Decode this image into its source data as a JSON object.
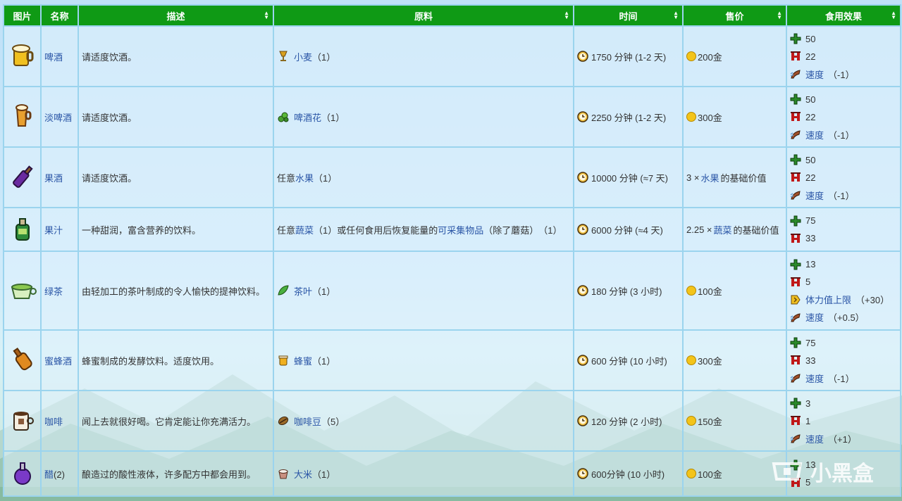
{
  "headers": {
    "image": "图片",
    "name": "名称",
    "desc": "描述",
    "ingredients": "原料",
    "time": "时间",
    "price": "售价",
    "effects": "食用效果"
  },
  "rows": [
    {
      "icon": "beer-icon",
      "name": "啤酒",
      "desc": "请适度饮酒。",
      "ingredient": {
        "prefix": "",
        "icon": "wheat-icon",
        "link": "小麦",
        "mid": "",
        "link2": "",
        "suffix": "（1）"
      },
      "time": "1750 分钟 (1-2 天)",
      "price": {
        "link": "",
        "text": "200金",
        "coin": true
      },
      "effects": [
        {
          "icon": "energy-icon",
          "text": "50"
        },
        {
          "icon": "health-icon",
          "text": "22"
        },
        {
          "icon": "speed-icon",
          "link": "速度",
          "text": "（-1）"
        }
      ]
    },
    {
      "icon": "pale-ale-icon",
      "name": "淡啤酒",
      "desc": "请适度饮酒。",
      "ingredient": {
        "prefix": "",
        "icon": "hops-icon",
        "link": "啤酒花",
        "mid": "",
        "link2": "",
        "suffix": "（1）"
      },
      "time": "2250 分钟 (1-2 天)",
      "price": {
        "link": "",
        "text": "300金",
        "coin": true
      },
      "effects": [
        {
          "icon": "energy-icon",
          "text": "50"
        },
        {
          "icon": "health-icon",
          "text": "22"
        },
        {
          "icon": "speed-icon",
          "link": "速度",
          "text": "（-1）"
        }
      ]
    },
    {
      "icon": "wine-icon",
      "name": "果酒",
      "desc": "请适度饮酒。",
      "ingredient": {
        "prefix": "任意",
        "icon": "",
        "link": "水果",
        "mid": "",
        "link2": "",
        "suffix": "（1）"
      },
      "time": "10000 分钟 (≈7 天)",
      "price": {
        "prefix": "3 × ",
        "link": "水果",
        "text": "的基础价值",
        "coin": false
      },
      "effects": [
        {
          "icon": "energy-icon",
          "text": "50"
        },
        {
          "icon": "health-icon",
          "text": "22"
        },
        {
          "icon": "speed-icon",
          "link": "速度",
          "text": "（-1）"
        }
      ]
    },
    {
      "icon": "juice-icon",
      "name": "果汁",
      "desc": "一种甜润，富含营养的饮料。",
      "ingredient": {
        "prefix": "任意",
        "icon": "",
        "link": "蔬菜",
        "mid": "（1）或任何食用后恢复能量的",
        "link2": "可采集物品",
        "suffix": "（除了蘑菇）　（1）"
      },
      "time": "6000 分钟 (≈4 天)",
      "price": {
        "prefix": "2.25 × ",
        "link": "蔬菜",
        "text": "的基础价值",
        "coin": false
      },
      "effects": [
        {
          "icon": "energy-icon",
          "text": "75"
        },
        {
          "icon": "health-icon",
          "text": "33"
        }
      ]
    },
    {
      "icon": "green-tea-icon",
      "name": "绿茶",
      "desc": "由轻加工的茶叶制成的令人愉快的提神饮料。",
      "ingredient": {
        "prefix": "",
        "icon": "tea-leaves-icon",
        "link": "茶叶",
        "mid": "",
        "link2": "",
        "suffix": "（1）"
      },
      "time": "180 分钟 (3 小时)",
      "price": {
        "link": "",
        "text": "100金",
        "coin": true
      },
      "effects": [
        {
          "icon": "energy-icon",
          "text": "13"
        },
        {
          "icon": "health-icon",
          "text": "5"
        },
        {
          "icon": "max-energy-icon",
          "link": "体力值上限",
          "text": "（+30）"
        },
        {
          "icon": "speed-icon",
          "link": "速度",
          "text": "（+0.5）"
        }
      ]
    },
    {
      "icon": "mead-icon",
      "name": "蜜蜂酒",
      "desc": "蜂蜜制成的发酵饮料。适度饮用。",
      "ingredient": {
        "prefix": "",
        "icon": "honey-icon",
        "link": "蜂蜜",
        "mid": "",
        "link2": "",
        "suffix": "（1）"
      },
      "time": "600 分钟 (10 小时)",
      "price": {
        "link": "",
        "text": "300金",
        "coin": true
      },
      "effects": [
        {
          "icon": "energy-icon",
          "text": "75"
        },
        {
          "icon": "health-icon",
          "text": "33"
        },
        {
          "icon": "speed-icon",
          "link": "速度",
          "text": "（-1）"
        }
      ]
    },
    {
      "icon": "coffee-icon",
      "name": "咖啡",
      "desc": "闻上去就很好喝。它肯定能让你充满活力。",
      "ingredient": {
        "prefix": "",
        "icon": "coffee-bean-icon",
        "link": "咖啡豆",
        "mid": "",
        "link2": "",
        "suffix": "（5）"
      },
      "time": "120 分钟 (2 小时)",
      "price": {
        "link": "",
        "text": "150金",
        "coin": true
      },
      "effects": [
        {
          "icon": "energy-icon",
          "text": "3"
        },
        {
          "icon": "health-icon",
          "text": "1"
        },
        {
          "icon": "speed-icon",
          "link": "速度",
          "text": "（+1）"
        }
      ]
    },
    {
      "icon": "vinegar-icon",
      "name": "醋",
      "name_suffix": "(2)",
      "desc": "酿造过的酸性液体，许多配方中都会用到。",
      "ingredient": {
        "prefix": "",
        "icon": "rice-icon",
        "link": "大米",
        "mid": "",
        "link2": "",
        "suffix": "（1）"
      },
      "time": "600分钟 (10 小时)",
      "price": {
        "link": "",
        "text": "100金",
        "coin": true
      },
      "effects": [
        {
          "icon": "energy-icon",
          "text": "13"
        },
        {
          "icon": "health-icon",
          "text": "5"
        }
      ]
    }
  ],
  "watermark": {
    "text": "小黑盒"
  }
}
